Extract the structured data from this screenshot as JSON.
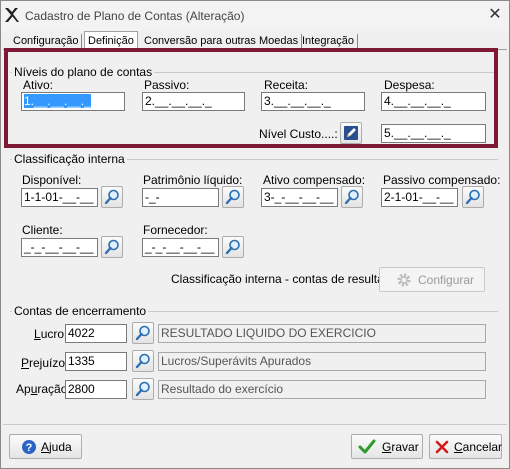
{
  "window": {
    "title": "Cadastro de Plano de Contas (Alteração)",
    "close_glyph": "✕"
  },
  "tabs": [
    {
      "label": "Configuração"
    },
    {
      "label": "Definição"
    },
    {
      "label": "Conversão para outras Moedas"
    },
    {
      "label": "Integração"
    }
  ],
  "niveis": {
    "title": "Níveis do plano de contas",
    "ativo": {
      "label": "Ativo:",
      "value_selected": "1.__.__.__._",
      "value": ""
    },
    "passivo": {
      "label": "Passivo:",
      "value": "2.__.__.__._"
    },
    "receita": {
      "label": "Receita:",
      "value": "3.__.__.__._"
    },
    "despesa": {
      "label": "Despesa:",
      "value": "4.__.__.__._"
    },
    "nivel_custo": {
      "label": "Nível Custo....:",
      "value": "5.__.__.__._"
    }
  },
  "classificacao": {
    "title": "Classificação interna",
    "disponivel": {
      "label": "Disponível:",
      "value": "1-1-01-__-__"
    },
    "patrimonio": {
      "label": "Patrimônio líquido:",
      "value": "-_-"
    },
    "ativo_compensado": {
      "label": "Ativo compensado:",
      "value": "3-_-__-__-__"
    },
    "passivo_compensado": {
      "label": "Passivo compensado:",
      "value": "2-1-01-__-__"
    },
    "cliente": {
      "label": "Cliente:",
      "value": "_-_-__-__-__"
    },
    "fornecedor": {
      "label": "Fornecedor:",
      "value": "_-_-__-__-__"
    },
    "resultado_label": "Classificação interna - contas de resultado:",
    "configurar_button": "Configurar"
  },
  "encerramento": {
    "title": "Contas de encerramento",
    "lucro": {
      "label_u": "L",
      "label_rest": "ucro",
      "code": "4022",
      "description": "RESULTADO LIQUIDO DO EXERCICIO"
    },
    "prejuizo": {
      "label_u": "P",
      "label_rest": "rejuízo",
      "code": "1335",
      "description": "Lucros/Superávits Apurados"
    },
    "apuracao": {
      "label_pre": "Ap",
      "label_u": "u",
      "label_rest": "ração",
      "code": "2800",
      "description": "Resultado do exercício"
    }
  },
  "footer": {
    "ajuda": {
      "label_u": "A",
      "label_rest": "juda"
    },
    "gravar": {
      "label_u": "G",
      "label_rest": "ravar"
    },
    "cancelar": {
      "label_u": "C",
      "label_rest": "ancelar"
    }
  },
  "colors": {
    "highlight_border": "#7d1935",
    "selection": "#3399ff",
    "check_green": "#2e9b2e",
    "cancel_red": "#d01c1c"
  }
}
